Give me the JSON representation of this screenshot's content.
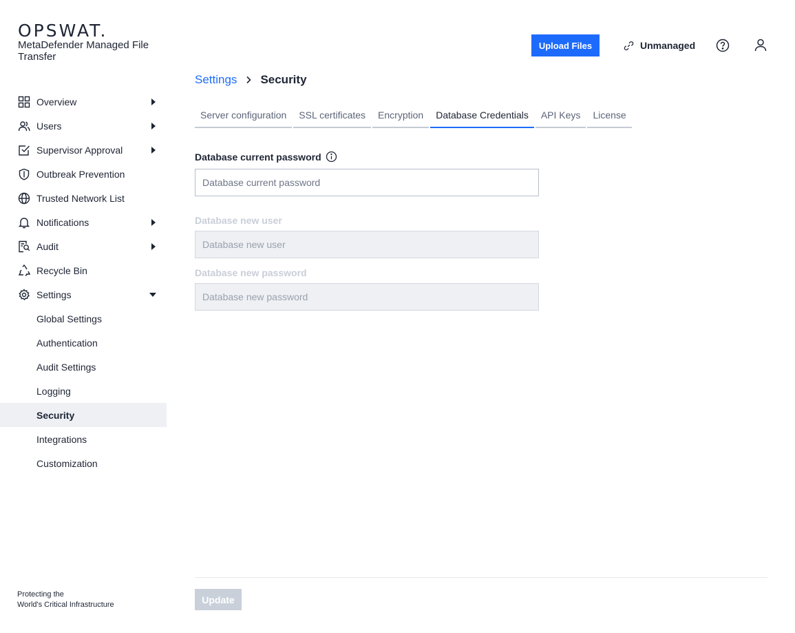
{
  "brand": {
    "logo": "OPSWAT.",
    "product": "MetaDefender Managed File Transfer",
    "tagline_line1": "Protecting the",
    "tagline_line2": "World's Critical Infrastructure"
  },
  "header": {
    "upload_label": "Upload Files",
    "status_label": "Unmanaged"
  },
  "sidebar": {
    "items": [
      {
        "label": "Overview",
        "icon": "grid-icon",
        "expandable": true
      },
      {
        "label": "Users",
        "icon": "users-icon",
        "expandable": true
      },
      {
        "label": "Supervisor Approval",
        "icon": "checkbox-icon",
        "expandable": true
      },
      {
        "label": "Outbreak Prevention",
        "icon": "shield-icon",
        "expandable": false
      },
      {
        "label": "Trusted Network List",
        "icon": "globe-icon",
        "expandable": false
      },
      {
        "label": "Notifications",
        "icon": "bell-icon",
        "expandable": true
      },
      {
        "label": "Audit",
        "icon": "audit-icon",
        "expandable": true
      },
      {
        "label": "Recycle Bin",
        "icon": "recycle-icon",
        "expandable": false
      },
      {
        "label": "Settings",
        "icon": "gear-icon",
        "expandable": true,
        "expanded": true
      }
    ],
    "sub_items": [
      {
        "label": "Global Settings"
      },
      {
        "label": "Authentication"
      },
      {
        "label": "Audit Settings"
      },
      {
        "label": "Logging"
      },
      {
        "label": "Security",
        "active": true
      },
      {
        "label": "Integrations"
      },
      {
        "label": "Customization"
      }
    ]
  },
  "breadcrumb": {
    "parent": "Settings",
    "current": "Security"
  },
  "tabs": [
    {
      "label": "Server configuration"
    },
    {
      "label": "SSL certificates"
    },
    {
      "label": "Encryption"
    },
    {
      "label": "Database Credentials",
      "active": true
    },
    {
      "label": "API Keys"
    },
    {
      "label": "License"
    }
  ],
  "form": {
    "current_password_label": "Database current password",
    "current_password_placeholder": "Database current password",
    "new_user_label": "Database new user",
    "new_user_placeholder": "Database new user",
    "new_password_label": "Database new password",
    "new_password_placeholder": "Database new password",
    "update_label": "Update"
  },
  "colors": {
    "accent": "#1d6bfc",
    "text": "#1d2433",
    "active_bg": "#eef0f4",
    "disabled_button": "#c9d0da"
  }
}
